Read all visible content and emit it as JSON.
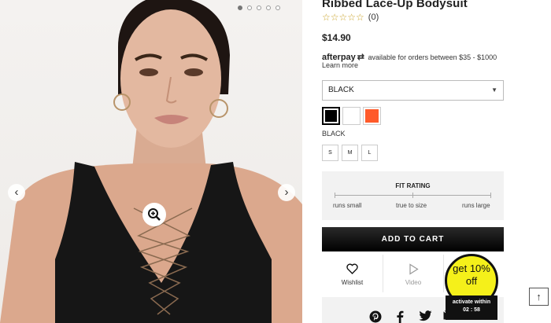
{
  "product": {
    "title": "Ribbed Lace-Up Bodysuit",
    "stars": "☆☆☆☆☆",
    "review_count": "(0)",
    "price": "$14.90"
  },
  "afterpay": {
    "logo": "afterpay",
    "text": "available for orders between $35 - $1000",
    "learn_more": "Learn more"
  },
  "color_select": {
    "value": "BLACK",
    "swatches": [
      "#000000",
      "#ffffff",
      "#ff5a2a"
    ],
    "selected_label": "BLACK"
  },
  "sizes": [
    "S",
    "M",
    "L"
  ],
  "fit_rating": {
    "title": "FIT RATING",
    "labels": [
      "runs small",
      "true to size",
      "runs large"
    ]
  },
  "cart_button": "ADD TO CART",
  "actions": {
    "wishlist": "Wishlist",
    "video": "Video"
  },
  "promo": {
    "line1": "get 10%",
    "line2": "off",
    "activate": "activate within",
    "countdown": "02 : 58"
  },
  "back_to_top": "↑",
  "gallery": {
    "prev": "‹",
    "next": "›"
  }
}
